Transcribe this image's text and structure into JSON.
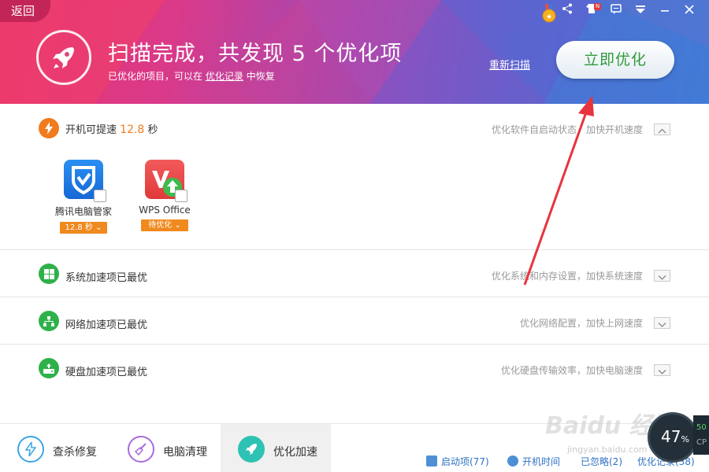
{
  "header": {
    "back_label": "返回",
    "title": "扫描完成，共发现 5 个优化项",
    "subtitle_prefix": "已优化的项目，可以在",
    "subtitle_link": "优化记录",
    "subtitle_suffix": "中恢复",
    "rescan_label": "重新扫描",
    "optimize_label": "立即优化",
    "notify_badge": "N"
  },
  "sections": {
    "startup": {
      "title_prefix": "开机可提速",
      "value": "12.8",
      "unit": "秒",
      "desc": "优化软件自启动状态，加快开机速度",
      "apps": [
        {
          "name": "腾讯电脑管家",
          "tag": "12.8 秒"
        },
        {
          "name": "WPS Office",
          "tag": "待优化"
        }
      ]
    },
    "system": {
      "title": "系统加速项已最优",
      "desc": "优化系统和内存设置，加快系统速度"
    },
    "network": {
      "title": "网络加速项已最优",
      "desc": "优化网络配置，加快上网速度"
    },
    "disk": {
      "title": "硬盘加速项已最优",
      "desc": "优化硬盘传输效率，加快电脑速度"
    }
  },
  "bottom_nav": [
    {
      "label": "查杀修复"
    },
    {
      "label": "电脑清理"
    },
    {
      "label": "优化加速"
    }
  ],
  "bottom_links": [
    {
      "label": "启动项(77)"
    },
    {
      "label": "开机时间"
    },
    {
      "label": "已忽略(2)"
    },
    {
      "label": "优化记录(38)"
    }
  ],
  "gauge": {
    "value": "47",
    "unit": "%",
    "side_top": "50",
    "side_bottom": "CP"
  },
  "watermark": {
    "brand": "Baidu 经验",
    "url": "jingyan.baidu.com"
  },
  "colors": {
    "accent_orange": "#f07b1c",
    "green": "#2fb14a",
    "link_blue": "#2e71c4"
  }
}
